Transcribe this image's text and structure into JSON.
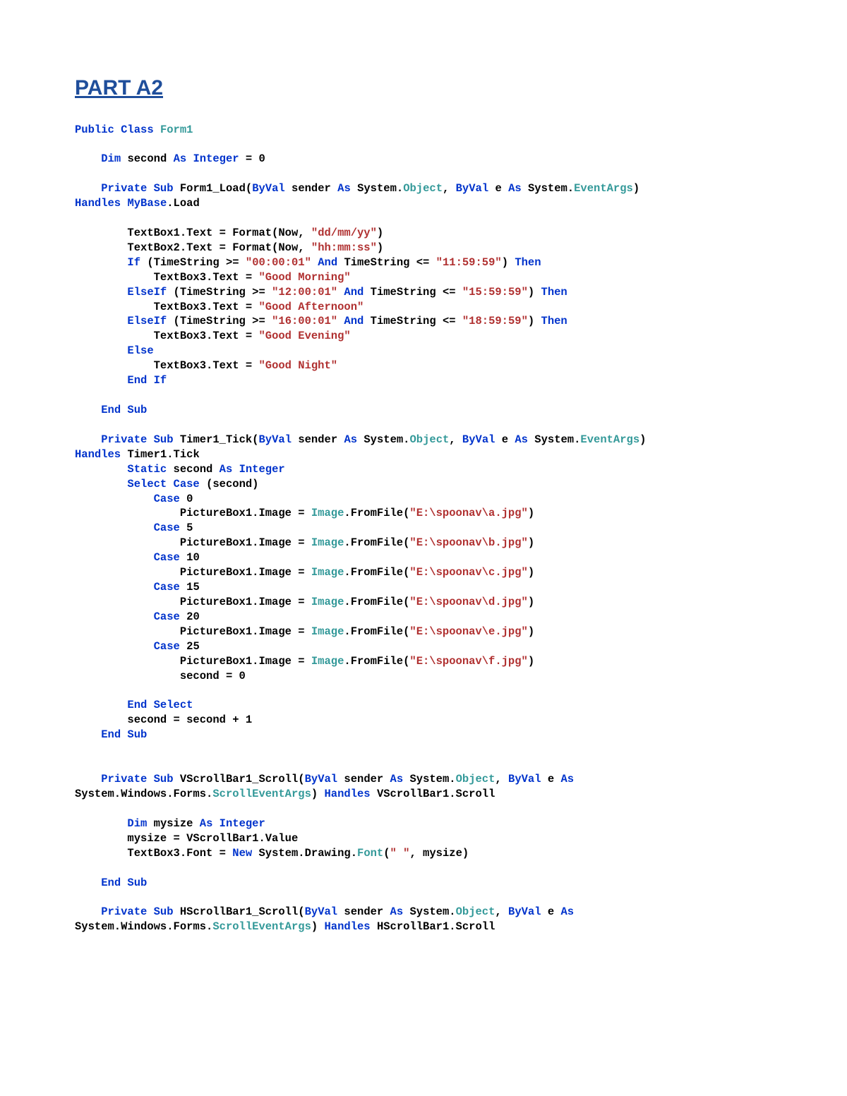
{
  "title": "PART A2",
  "code": {
    "classDecl": {
      "kw1": "Public Class",
      "name": "Form1"
    },
    "dimSecond": {
      "kw1": "Dim",
      "name": "second",
      "kw2": "As Integer",
      "eq": "= 0"
    },
    "formLoad": {
      "kw1": "Private Sub",
      "name": "Form1_Load(",
      "kw2": "ByVal",
      "p1": "sender",
      "kw3": "As",
      "sys1": "System.",
      "obj": "Object",
      "comma": ",",
      "kw4": "ByVal",
      "p2": "e",
      "kw5": "As",
      "sys2": "System.",
      "ea": "EventArgs",
      "close": ")",
      "kw6": "Handles",
      "base": "MyBase",
      "dotLoad": ".Load"
    },
    "tb1": {
      "left": "TextBox1.Text = Format(Now,",
      "str": "\"dd/mm/yy\"",
      "right": ")"
    },
    "tb2": {
      "left": "TextBox2.Text = Format(Now,",
      "str": "\"hh:mm:ss\"",
      "right": ")"
    },
    "if1": {
      "kw1": "If",
      "open": "(TimeString >=",
      "s1": "\"00:00:01\"",
      "kw2": "And",
      "mid": "TimeString <=",
      "s2": "\"11:59:59\"",
      "close": ")",
      "kw3": "Then"
    },
    "if1body": {
      "left": "TextBox3.Text =",
      "str": "\"Good Morning\""
    },
    "elif1": {
      "kw1": "ElseIf",
      "open": "(TimeString >=",
      "s1": "\"12:00:01\"",
      "kw2": "And",
      "mid": "TimeString <=",
      "s2": "\"15:59:59\"",
      "close": ")",
      "kw3": "Then"
    },
    "elif1body": {
      "left": "TextBox3.Text =",
      "str": "\"Good Afternoon\""
    },
    "elif2": {
      "kw1": "ElseIf",
      "open": "(TimeString >=",
      "s1": "\"16:00:01\"",
      "kw2": "And",
      "mid": "TimeString <=",
      "s2": "\"18:59:59\"",
      "close": ")",
      "kw3": "Then"
    },
    "elif2body": {
      "left": "TextBox3.Text =",
      "str": "\"Good Evening\""
    },
    "else": {
      "kw": "Else"
    },
    "elsebody": {
      "left": "TextBox3.Text =",
      "str": "\"Good Night\""
    },
    "endif": {
      "kw": "End If"
    },
    "endsub1": {
      "kw": "End Sub"
    },
    "timer": {
      "kw1": "Private Sub",
      "name": "Timer1_Tick(",
      "kw2": "ByVal",
      "p1": "sender",
      "kw3": "As",
      "sys1": "System.",
      "obj": "Object",
      "comma": ",",
      "kw4": "ByVal",
      "p2": "e",
      "kw5": "As",
      "sys2": "System.",
      "ea": "EventArgs",
      "close": ")",
      "kw6": "Handles",
      "h": "Timer1.Tick"
    },
    "static": {
      "kw1": "Static",
      "name": "second",
      "kw2": "As Integer"
    },
    "select": {
      "kw": "Select Case",
      "expr": "(second)"
    },
    "case0": {
      "kw": "Case",
      "n": "0"
    },
    "case0b": {
      "left": "PictureBox1.Image =",
      "img": "Image",
      "mid": ".FromFile(",
      "str": "\"E:\\spoonav\\a.jpg\"",
      "close": ")"
    },
    "case5": {
      "kw": "Case",
      "n": "5"
    },
    "case5b": {
      "left": "PictureBox1.Image =",
      "img": "Image",
      "mid": ".FromFile(",
      "str": "\"E:\\spoonav\\b.jpg\"",
      "close": ")"
    },
    "case10": {
      "kw": "Case",
      "n": "10"
    },
    "case10b": {
      "left": "PictureBox1.Image =",
      "img": "Image",
      "mid": ".FromFile(",
      "str": "\"E:\\spoonav\\c.jpg\"",
      "close": ")"
    },
    "case15": {
      "kw": "Case",
      "n": "15"
    },
    "case15b": {
      "left": "PictureBox1.Image =",
      "img": "Image",
      "mid": ".FromFile(",
      "str": "\"E:\\spoonav\\d.jpg\"",
      "close": ")"
    },
    "case20": {
      "kw": "Case",
      "n": "20"
    },
    "case20b": {
      "left": "PictureBox1.Image =",
      "img": "Image",
      "mid": ".FromFile(",
      "str": "\"E:\\spoonav\\e.jpg\"",
      "close": ")"
    },
    "case25": {
      "kw": "Case",
      "n": "25"
    },
    "case25b": {
      "left": "PictureBox1.Image =",
      "img": "Image",
      "mid": ".FromFile(",
      "str": "\"E:\\spoonav\\f.jpg\"",
      "close": ")"
    },
    "reset": {
      "txt": "second = 0"
    },
    "endselect": {
      "kw": "End Select"
    },
    "inc": {
      "txt": "second = second + 1"
    },
    "endsub2": {
      "kw": "End Sub"
    },
    "vscroll": {
      "kw1": "Private Sub",
      "name": "VScrollBar1_Scroll(",
      "kw2": "ByVal",
      "p1": "sender",
      "kw3": "As",
      "sys1": "System.",
      "obj": "Object",
      "comma": ",",
      "kw4": "ByVal",
      "p2": "e",
      "kw5": "As",
      "sys2": "System.Windows.Forms.",
      "sea": "ScrollEventArgs",
      "close": ")",
      "kw6": "Handles",
      "h": "VScrollBar1.Scroll"
    },
    "dimMysize": {
      "kw1": "Dim",
      "name": "mysize",
      "kw2": "As Integer"
    },
    "msAssign": {
      "txt": "mysize = VScrollBar1.Value"
    },
    "fontAssign": {
      "left": "TextBox3.Font =",
      "kw": "New",
      "mid": "System.Drawing.",
      "font": "Font",
      "open": "(",
      "str": "\" \"",
      "rest": ", mysize)"
    },
    "endsub3": {
      "kw": "End Sub"
    },
    "hscroll": {
      "kw1": "Private Sub",
      "name": "HScrollBar1_Scroll(",
      "kw2": "ByVal",
      "p1": "sender",
      "kw3": "As",
      "sys1": "System.",
      "obj": "Object",
      "comma": ",",
      "kw4": "ByVal",
      "p2": "e",
      "kw5": "As",
      "sys2": "System.Windows.Forms.",
      "sea": "ScrollEventArgs",
      "close": ")",
      "kw6": "Handles",
      "h": "HScrollBar1.Scroll"
    }
  }
}
